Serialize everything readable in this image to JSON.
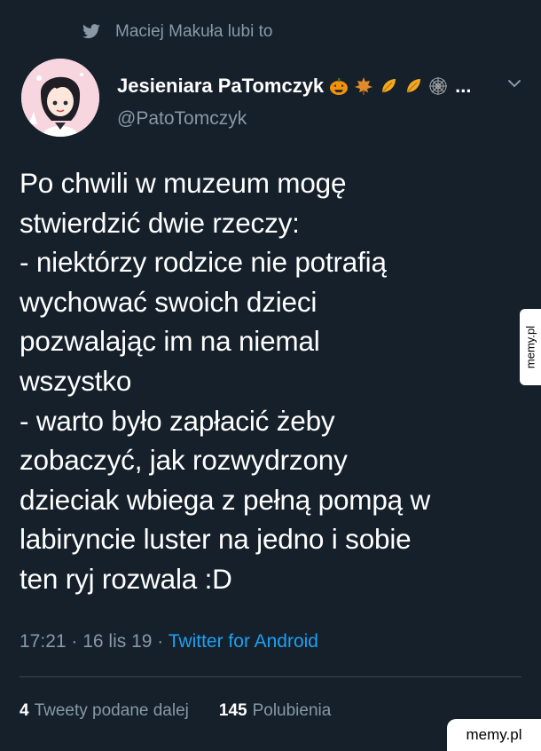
{
  "social_context": {
    "text": "Maciej Makuła lubi to",
    "icon": "twitter-bird-icon"
  },
  "author": {
    "display_name": "Jesieniara PaTomczyk",
    "ellipsis": "...",
    "handle": "@PatoTomczyk",
    "emojis": [
      "jack-o-lantern-icon",
      "maple-leaf-icon",
      "fallen-leaf-icon",
      "fallen-leaf-icon",
      "spider-web-icon"
    ]
  },
  "tweet": {
    "text": "Po chwili w muzeum mogę\nstwierdzić dwie rzeczy:\n- niektórzy rodzice nie potrafią\nwychować swoich dzieci\npozwalając im na niemal\nwszystko\n- warto było zapłacić żeby\nzobaczyć, jak rozwydrzony\ndzieciak wbiega z pełną pompą w\nlabiryncie luster na jedno i sobie\nten ryj rozwala :D",
    "time": "17:21",
    "date": "16 lis 19",
    "separator": " · ",
    "source": "Twitter for Android"
  },
  "stats": {
    "retweets_count": "4",
    "retweets_label": "Tweety podane dalej",
    "likes_count": "145",
    "likes_label": "Polubienia"
  },
  "watermarks": {
    "side": "memy.pl",
    "bottom": "memy.pl"
  },
  "colors": {
    "background": "#15202b",
    "secondary_text": "#8899a6",
    "link": "#1da1f2",
    "divider": "#38444d"
  }
}
